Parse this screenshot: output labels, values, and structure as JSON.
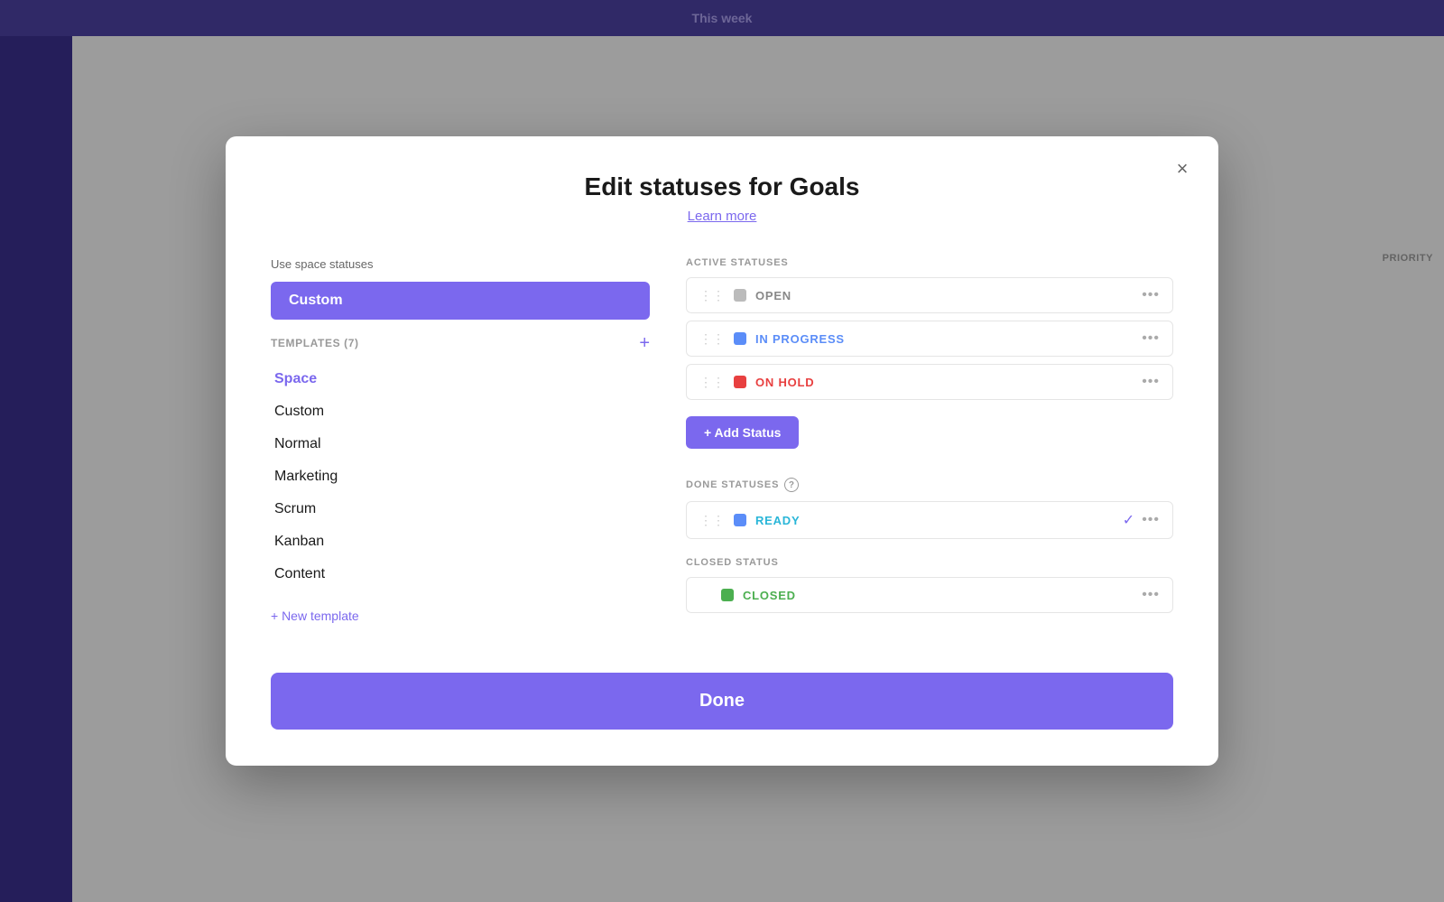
{
  "app": {
    "topbar_title": "This week"
  },
  "modal": {
    "title": "Edit statuses for Goals",
    "learn_more": "Learn more",
    "close_label": "×",
    "left": {
      "use_space_label": "Use space statuses",
      "custom_btn": "Custom",
      "templates_label": "TEMPLATES (7)",
      "templates_add": "+",
      "templates": [
        {
          "label": "Space",
          "active": true
        },
        {
          "label": "Custom",
          "active": false
        },
        {
          "label": "Normal",
          "active": false
        },
        {
          "label": "Marketing",
          "active": false
        },
        {
          "label": "Scrum",
          "active": false
        },
        {
          "label": "Kanban",
          "active": false
        },
        {
          "label": "Content",
          "active": false
        }
      ],
      "new_template": "+ New template"
    },
    "right": {
      "active_statuses_label": "ACTIVE STATUSES",
      "active_statuses": [
        {
          "name": "OPEN",
          "color": "gray",
          "drag": true
        },
        {
          "name": "IN PROGRESS",
          "color": "blue",
          "drag": true
        },
        {
          "name": "ON HOLD",
          "color": "red",
          "drag": true
        }
      ],
      "add_status_btn": "+ Add Status",
      "done_statuses_label": "DONE STATUSES",
      "done_statuses": [
        {
          "name": "READY",
          "color": "blue-done",
          "drag": true,
          "check": true
        }
      ],
      "closed_status_label": "CLOSED STATUS",
      "closed_statuses": [
        {
          "name": "CLOSED",
          "color": "green",
          "drag": false
        }
      ]
    },
    "done_btn": "Done"
  }
}
